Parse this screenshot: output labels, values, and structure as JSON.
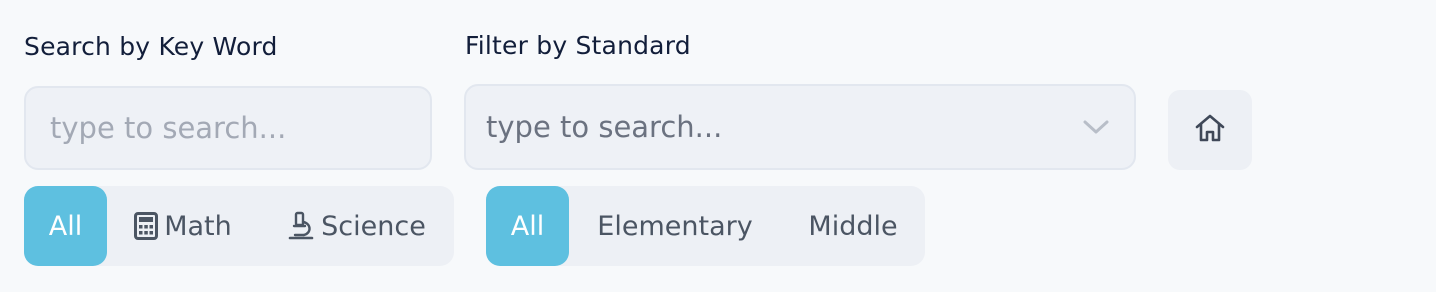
{
  "keyword_search": {
    "label": "Search by Key Word",
    "placeholder": "type to search..."
  },
  "standard_filter": {
    "label": "Filter by Standard",
    "placeholder": "type to search..."
  },
  "home_button": {
    "icon": "home-icon"
  },
  "subject_tabs": {
    "items": [
      {
        "label": "All",
        "icon": null,
        "active": true
      },
      {
        "label": "Math",
        "icon": "calculator-icon",
        "active": false
      },
      {
        "label": "Science",
        "icon": "microscope-icon",
        "active": false
      }
    ]
  },
  "level_tabs": {
    "items": [
      {
        "label": "All",
        "active": true
      },
      {
        "label": "Elementary",
        "active": false
      },
      {
        "label": "Middle",
        "active": false
      }
    ]
  },
  "colors": {
    "accent": "#5ec0e0",
    "background": "#f7f9fb",
    "control_bg": "#edf0f5",
    "label_text": "#121e3a"
  }
}
